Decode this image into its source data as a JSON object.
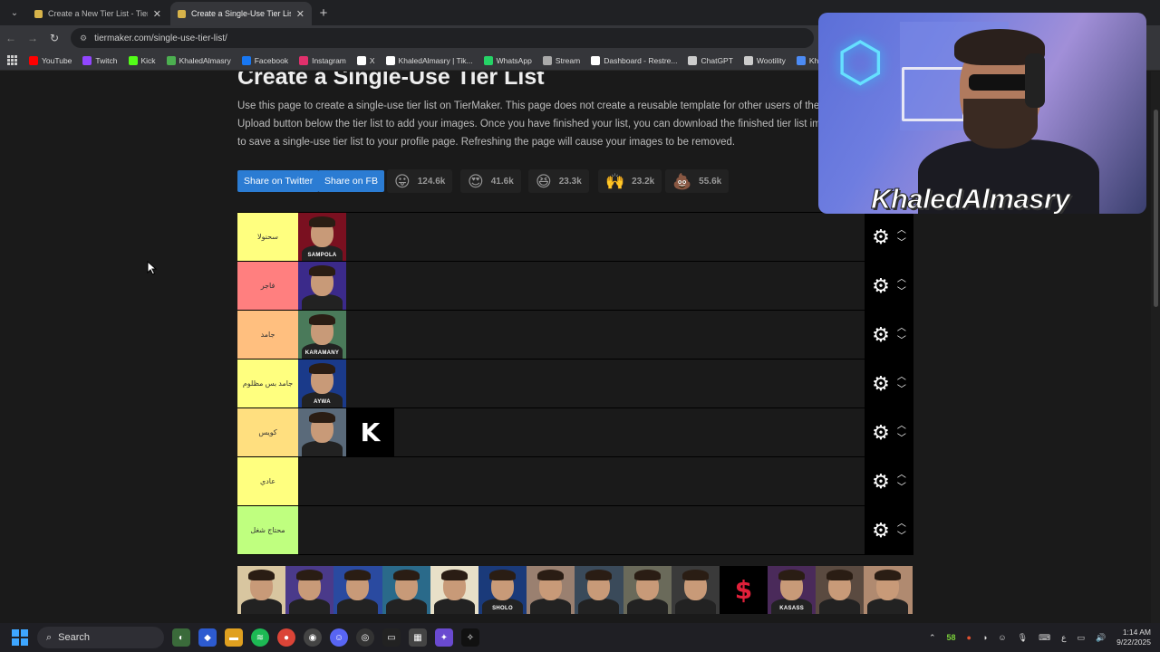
{
  "browser": {
    "tabs": [
      {
        "title": "Create a New Tier List - TierMaker",
        "active": false
      },
      {
        "title": "Create a Single-Use Tier List (Print...",
        "active": true
      }
    ],
    "url": "tiermaker.com/single-use-tier-list/",
    "bookmarks": [
      {
        "label": "YouTube",
        "color": "#ff0000"
      },
      {
        "label": "Twitch",
        "color": "#9146ff"
      },
      {
        "label": "Kick",
        "color": "#53fc18"
      },
      {
        "label": "KhaledAlmasry",
        "color": "#4caf50"
      },
      {
        "label": "Facebook",
        "color": "#1877f2"
      },
      {
        "label": "Instagram",
        "color": "#e1306c"
      },
      {
        "label": "X",
        "color": "#ffffff"
      },
      {
        "label": "KhaledAlmasry | Tik...",
        "color": "#ffffff"
      },
      {
        "label": "WhatsApp",
        "color": "#25d366"
      },
      {
        "label": "Stream",
        "color": "#aaaaaa"
      },
      {
        "label": "Dashboard - Restre...",
        "color": "#ffffff"
      },
      {
        "label": "ChatGPT",
        "color": "#cccccc"
      },
      {
        "label": "Wootility",
        "color": "#cccccc"
      },
      {
        "label": "KhaledAlm",
        "color": "#4c8bf5"
      }
    ]
  },
  "page": {
    "title": "Create a Single-Use Tier List",
    "description": [
      "Use this page to create a single-use tier list on TierMaker. This page does not create a reusable template for other users of the w",
      "Upload button below the tier list to add your images. Once you have finished your list, you can download the finished tier list ima",
      "to save a single-use tier list to your profile page. Refreshing the page will cause your images to be removed."
    ],
    "share_twitter": "Share on Twitter",
    "share_fb": "Share on FB",
    "reactions": [
      {
        "emoji": "😛",
        "count": "124.6k"
      },
      {
        "emoji": "😍",
        "count": "41.6k"
      },
      {
        "emoji": "😆",
        "count": "23.3k"
      },
      {
        "emoji": "🙌",
        "count": "23.2k"
      },
      {
        "emoji": "💩",
        "count": "55.6k"
      }
    ]
  },
  "tiers": [
    {
      "label": "سحنولا",
      "color": "#ffff7f",
      "items": [
        {
          "tag": "SAMPOLA",
          "bg": "#7a1020"
        }
      ]
    },
    {
      "label": "فاجر",
      "color": "#ff7f7f",
      "items": [
        {
          "tag": "",
          "bg": "#3b2a8a"
        }
      ]
    },
    {
      "label": "جامد",
      "color": "#ffbf7f",
      "items": [
        {
          "tag": "KARAMANY",
          "bg": "#4a7a5a"
        }
      ]
    },
    {
      "label": "جامد بس مظلوم",
      "color": "#ffff7f",
      "items": [
        {
          "tag": "AYWA",
          "bg": "#1a3a8a"
        }
      ]
    },
    {
      "label": "كويس",
      "color": "#ffdf7f",
      "items": [
        {
          "tag": "",
          "bg": "#5a6a7a"
        },
        {
          "tag": "K",
          "bg": "#000000",
          "logo": true
        }
      ]
    },
    {
      "label": "عادي",
      "color": "#ffff7f",
      "items": []
    },
    {
      "label": "محتاج شغل",
      "color": "#bfff7f",
      "items": []
    }
  ],
  "pool": [
    {
      "bg": "#d8c6a0"
    },
    {
      "bg": "#4a3a8a"
    },
    {
      "bg": "#2a4aa0"
    },
    {
      "bg": "#2a6a8a"
    },
    {
      "bg": "#e8e0c8"
    },
    {
      "bg": "#1a3a7a",
      "tag": "SHOLO"
    },
    {
      "bg": "#9a8070"
    },
    {
      "bg": "#3a4a5a"
    },
    {
      "bg": "#6a6a5a"
    },
    {
      "bg": "#3a3a3a"
    },
    {
      "bg": "#000000",
      "logo_red": true
    },
    {
      "bg": "#4a2a5a",
      "tag": "KASASS"
    },
    {
      "bg": "#5a4a40"
    },
    {
      "bg": "#b08a70"
    }
  ],
  "overlay": {
    "name": "KhaledAlmasry"
  },
  "taskbar": {
    "search": "Search",
    "badge": "58",
    "lang": "ع",
    "time": "1:14 AM",
    "date": "9/22/2025"
  }
}
